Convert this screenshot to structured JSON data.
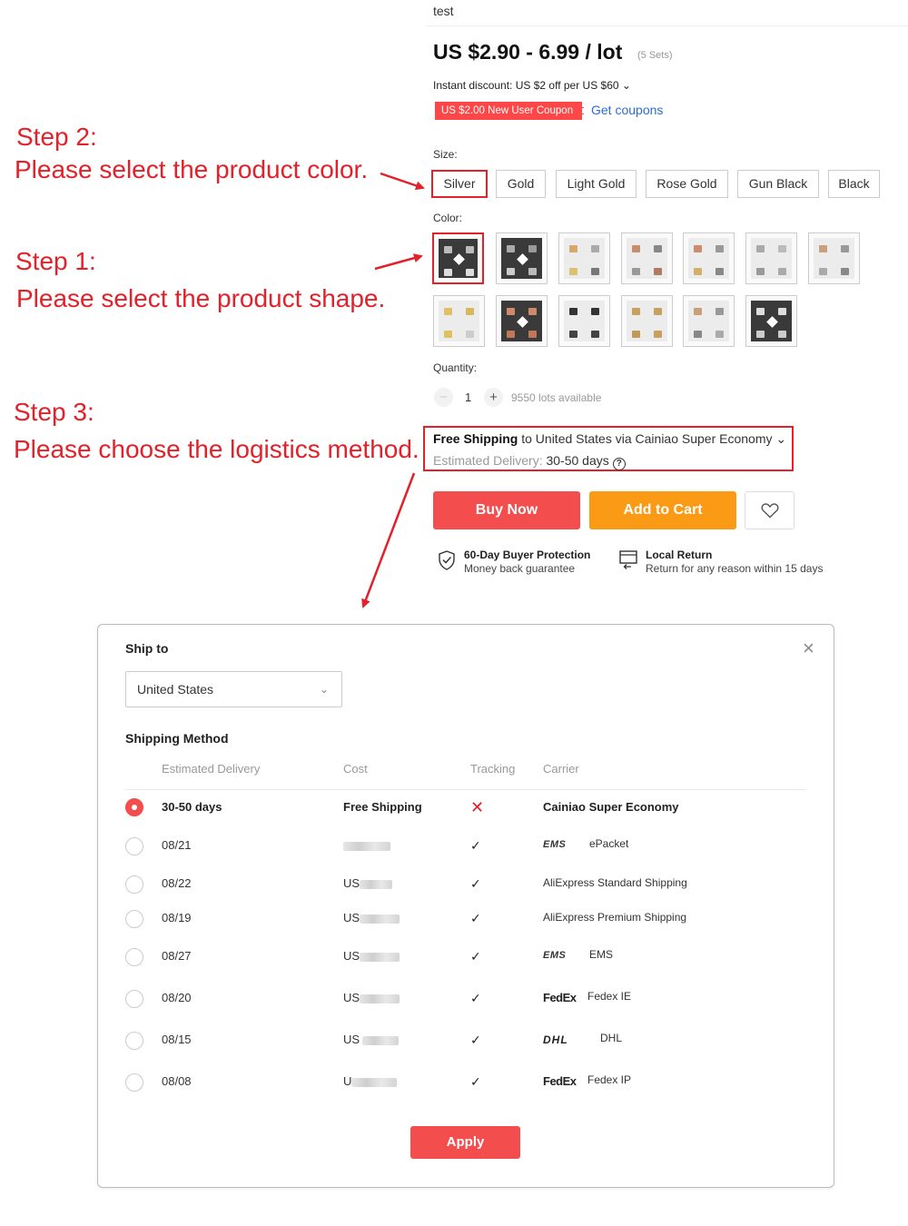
{
  "product": {
    "title": "test",
    "price": "US $2.90 - 6.99 / lot",
    "price_note": "(5 Sets)",
    "instant_discount": "Instant discount: US $2 off per US $60 ⌄",
    "coupon_badge": "US $2.00 New User Coupon",
    "get_coupons": "Get coupons",
    "size_label": "Size:",
    "sizes": [
      "Silver",
      "Gold",
      "Light Gold",
      "Rose Gold",
      "Gun Black",
      "Black"
    ],
    "selected_size": "Silver",
    "color_label": "Color:",
    "color_swatch_count": 13,
    "quantity_label": "Quantity:",
    "quantity_minus": "−",
    "quantity_value": "1",
    "quantity_plus": "+",
    "quantity_available": "9550 lots available",
    "shipping": {
      "free": "Free Shipping",
      "rest": " to United States via Cainiao Super Economy ⌄",
      "estimated_label": "Estimated Delivery: ",
      "estimated_days": "30-50 days",
      "help": "?"
    },
    "buy_now": "Buy Now",
    "add_to_cart": "Add to Cart",
    "guarantees": [
      {
        "title": "60-Day Buyer Protection",
        "subtitle": "Money back guarantee"
      },
      {
        "title": "Local Return",
        "subtitle": "Return for any reason within 15 days"
      }
    ]
  },
  "annotations": {
    "step2_title": "Step 2:",
    "step2_text": "Please select the product color.",
    "step1_title": "Step 1:",
    "step1_text": "Please select the product shape.",
    "step3_title": "Step 3:",
    "step3_text": "Please choose the logistics method."
  },
  "modal": {
    "close": "×",
    "ship_to_label": "Ship to",
    "country": "United States",
    "shipping_method_label": "Shipping Method",
    "columns": [
      "Estimated Delivery",
      "Cost",
      "Tracking",
      "Carrier"
    ],
    "rows": [
      {
        "delivery": "30-50 days",
        "cost": "Free Shipping",
        "tracking": "no",
        "carrier": "Cainiao Super Economy",
        "logo": "",
        "selected": true
      },
      {
        "delivery": "08/21",
        "cost": "",
        "tracking": "yes",
        "carrier": "ePacket",
        "logo": "EMS",
        "selected": false
      },
      {
        "delivery": "08/22",
        "cost": "US",
        "tracking": "yes",
        "carrier": "AliExpress Standard Shipping",
        "logo": "",
        "selected": false
      },
      {
        "delivery": "08/19",
        "cost": "US",
        "tracking": "yes",
        "carrier": "AliExpress Premium Shipping",
        "logo": "",
        "selected": false
      },
      {
        "delivery": "08/27",
        "cost": "US",
        "tracking": "yes",
        "carrier": "EMS",
        "logo": "EMS",
        "selected": false
      },
      {
        "delivery": "08/20",
        "cost": "US",
        "tracking": "yes",
        "carrier": "Fedex IE",
        "logo": "FedEx",
        "selected": false
      },
      {
        "delivery": "08/15",
        "cost": "US",
        "tracking": "yes",
        "carrier": "DHL",
        "logo": "DHL",
        "selected": false
      },
      {
        "delivery": "08/08",
        "cost": "U",
        "tracking": "yes",
        "carrier": "Fedex IP",
        "logo": "FedEx",
        "selected": false
      }
    ],
    "apply": "Apply"
  },
  "colors": {
    "accent_red": "#e3212b",
    "buy_now": "#f44d4d",
    "add_to_cart": "#fb9a14",
    "link_blue": "#2f6bd7"
  }
}
